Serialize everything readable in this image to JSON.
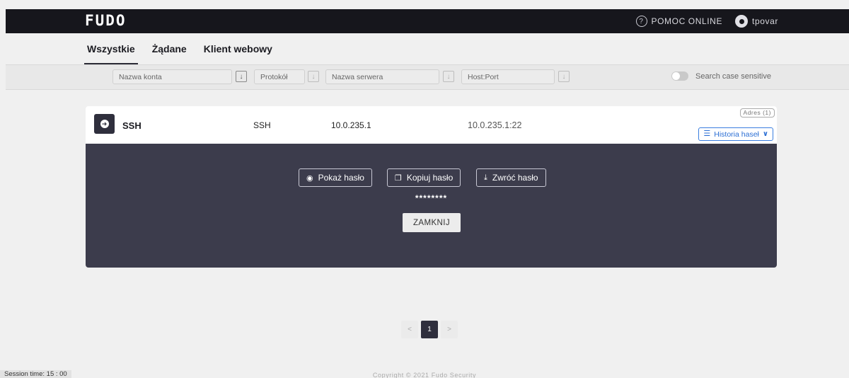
{
  "header": {
    "logo": "FUDO",
    "help_label": "POMOC ONLINE",
    "help_icon": "?",
    "username": "tpovar"
  },
  "tabs": [
    {
      "label": "Wszystkie",
      "active": true
    },
    {
      "label": "Żądane",
      "active": false
    },
    {
      "label": "Klient webowy",
      "active": false
    }
  ],
  "filters": {
    "account_placeholder": "Nazwa konta",
    "protocol_placeholder": "Protokół",
    "server_placeholder": "Nazwa serwera",
    "hostport_placeholder": "Host:Port",
    "sort_icon": "↓",
    "case_sensitive_label": "Search case sensitive"
  },
  "account": {
    "name": "SSH",
    "protocol": "SSH",
    "server": "10.0.235.1",
    "host": "10.0.235.1:22",
    "address_badge": "Adres (1)",
    "history_label": "Historia haseł"
  },
  "panel": {
    "show_label": "Pokaż hasło",
    "copy_label": "Kopiuj hasło",
    "return_label": "Zwróć hasło",
    "masked_password": "********",
    "close_label": "ZAMKNIJ"
  },
  "pagination": {
    "prev": "<",
    "current": "1",
    "next": ">"
  },
  "footer": {
    "session": "Session time: 15 : 00",
    "copyright": "Copyright © 2021 Fudo Security"
  }
}
